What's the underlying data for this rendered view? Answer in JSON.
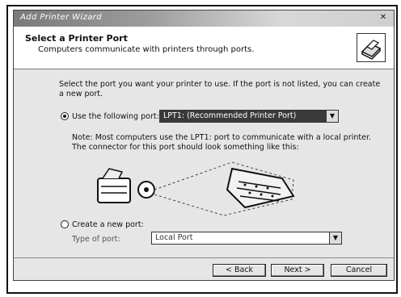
{
  "window": {
    "title": "Add Printer Wizard"
  },
  "header": {
    "title": "Select a Printer Port",
    "subtitle": "Computers communicate with printers through ports."
  },
  "intro_text": "Select the port you want your printer to use. If the port is not listed, you can create a new port.",
  "option_existing": {
    "label": "Use the following port:",
    "selected": true,
    "value": "LPT1: (Recommended Printer Port)"
  },
  "note_text": "Note: Most computers use the LPT1: port to communicate with a local printer. The connector for this port should look something like this:",
  "option_new": {
    "label": "Create a new port:",
    "selected": false,
    "type_label": "Type of port:",
    "type_value": "Local Port"
  },
  "buttons": {
    "back": "< Back",
    "next": "Next >",
    "cancel": "Cancel"
  },
  "icons": {
    "close": "close-icon",
    "printer": "printer-icon",
    "dropdown": "chevron-down-icon"
  }
}
